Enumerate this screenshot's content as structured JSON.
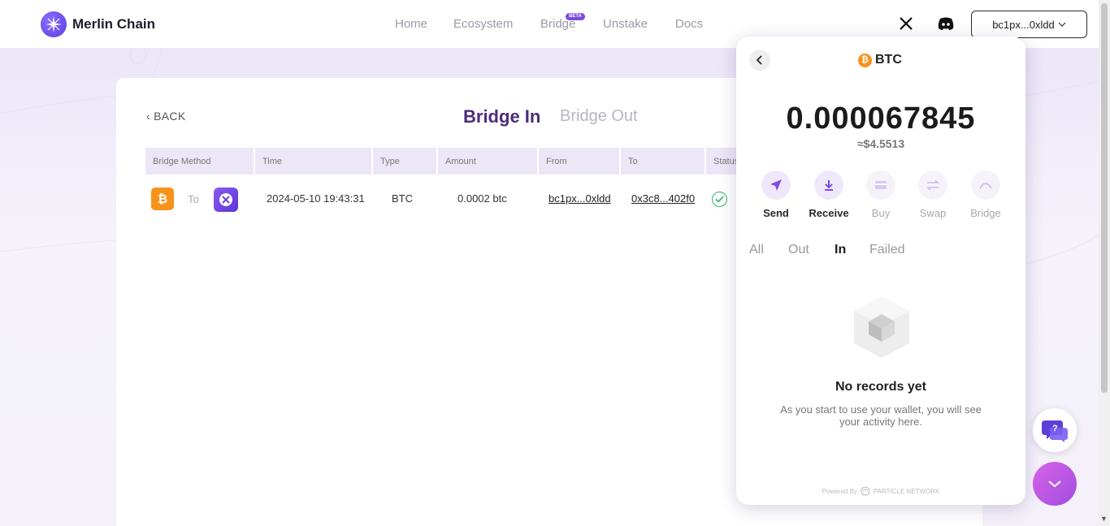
{
  "header": {
    "brand": "Merlin Chain",
    "nav": [
      "Home",
      "Ecosystem",
      "Bridge",
      "Unstake",
      "Docs"
    ],
    "beta_badge": "BETA",
    "wallet_address": "bc1px...0xldd",
    "icons": [
      "merlin-logo-icon",
      "x-twitter-icon",
      "discord-icon",
      "chevron-down-icon"
    ]
  },
  "bridge": {
    "back_label": "BACK",
    "tabs": [
      "Bridge In",
      "Bridge Out"
    ],
    "active_tab": "Bridge In",
    "columns": [
      "Bridge Method",
      "Time",
      "Type",
      "Amount",
      "From",
      "To",
      "Status"
    ],
    "rows": [
      {
        "method_to": "To",
        "time": "2024-05-10 19:43:31",
        "type": "BTC",
        "amount": "0.0002 btc",
        "from": "bc1px...0xldd",
        "to": "0x3c8...402f0"
      }
    ]
  },
  "wallet_panel": {
    "title": "BTC",
    "balance": "0.000067845",
    "usd_value": "≈$4.5513",
    "actions": [
      {
        "label": "Send",
        "enabled": true
      },
      {
        "label": "Receive",
        "enabled": true
      },
      {
        "label": "Buy",
        "enabled": false
      },
      {
        "label": "Swap",
        "enabled": false
      },
      {
        "label": "Bridge",
        "enabled": false
      }
    ],
    "filters": [
      "All",
      "Out",
      "In",
      "Failed"
    ],
    "active_filter": "In",
    "empty_title": "No records yet",
    "empty_desc": "As you start to use your wallet, you will see your activity here.",
    "powered_by": "Powered By",
    "powered_brand": "PARTICLE NETWORK"
  },
  "colors": {
    "accent": "#4b2d7a",
    "btc": "#f7931a",
    "success": "#2db46f",
    "fab": "#c05ae6"
  }
}
